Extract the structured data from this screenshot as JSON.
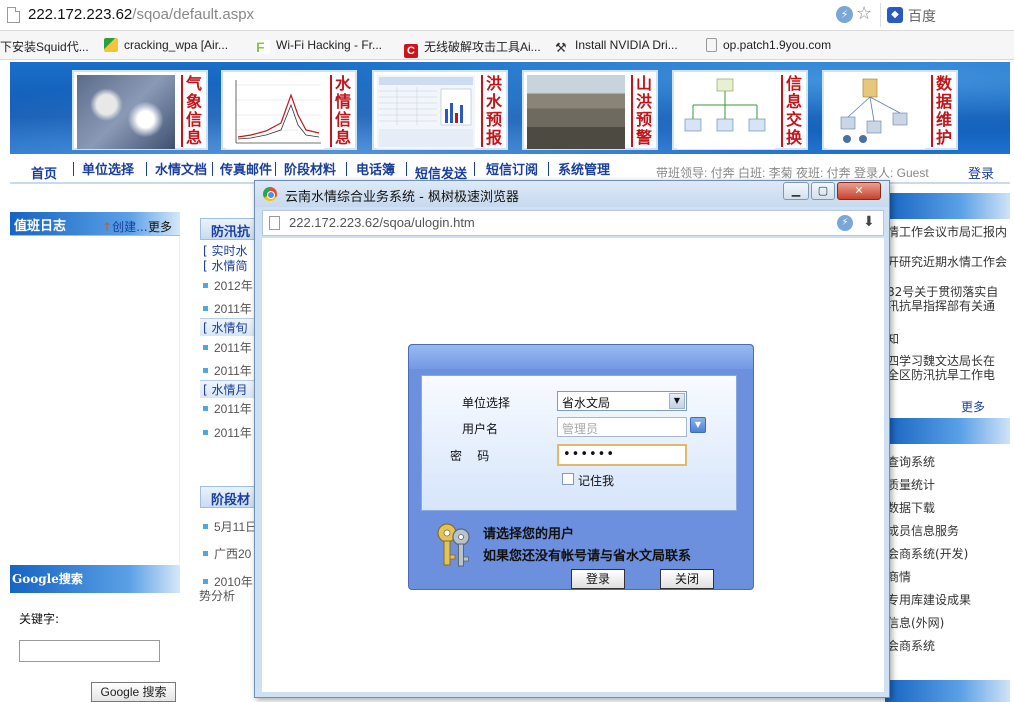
{
  "browser": {
    "url_host": "222.172.223.62",
    "url_path": "/sqoa/default.aspx",
    "search_engine": "百度"
  },
  "bookmarks": [
    {
      "label": "下安装Squid代...",
      "icon": "none",
      "color": ""
    },
    {
      "label": "cracking_wpa [Air...",
      "icon": "pencil-icon",
      "color": "#2e9e3a"
    },
    {
      "label": "Wi-Fi Hacking - Fr...",
      "icon": "f-logo-icon",
      "color": "#8bc34a"
    },
    {
      "label": "无线破解攻击工具Ai...",
      "icon": "c-logo-icon",
      "color": "#d0121b"
    },
    {
      "label": "Install NVIDIA Dri...",
      "icon": "wrench-icon",
      "color": "#555555"
    },
    {
      "label": "op.patch1.9you.com",
      "icon": "page-icon",
      "color": "#999999"
    }
  ],
  "header_tiles": [
    {
      "text": "气象信息",
      "picture": "weather-satellite-image"
    },
    {
      "text": "水情信息",
      "picture": "water-level-chart-image"
    },
    {
      "text": "洪水预报",
      "picture": "flood-forecast-table-image"
    },
    {
      "text": "山洪预警",
      "picture": "landslide-photo-image"
    },
    {
      "text": "信息交换",
      "picture": "network-diagram-image"
    },
    {
      "text": "数据维护",
      "picture": "server-diagram-image"
    }
  ],
  "nav": {
    "items": [
      "首页",
      "单位选择",
      "水情文档",
      "传真邮件",
      "阶段材料",
      "电话簿",
      "短信发送",
      "短信订阅",
      "系统管理"
    ],
    "duty_text": "带班领导: 付奔  白班: 李菊  夜班: 付奔  登录人: Guest",
    "login": "登录"
  },
  "left": {
    "duty_log_title": "值班日志",
    "create": "创建...",
    "more": "更多",
    "google_title": "Google搜索",
    "keyword_label": "关键字:",
    "search_button": "Google 搜索"
  },
  "middle": {
    "title_top": "防汛抗",
    "items": [
      {
        "kind": "link",
        "text": "[ 实时水"
      },
      {
        "kind": "link",
        "text": "[ 水情简"
      },
      {
        "kind": "line",
        "text": "2012年"
      },
      {
        "kind": "line",
        "text": "2011年"
      },
      {
        "kind": "link",
        "text": "[ 水情旬"
      },
      {
        "kind": "line",
        "text": "2011年"
      },
      {
        "kind": "line",
        "text": "2011年"
      },
      {
        "kind": "link",
        "text": "[ 水情月"
      },
      {
        "kind": "line",
        "text": "2011年"
      },
      {
        "kind": "line",
        "text": "2011年"
      }
    ],
    "title_stage": "阶段材",
    "stage_items": [
      "5月11日",
      "广西20",
      "2010年"
    ],
    "trailing": "势分析"
  },
  "right": {
    "items_top": [
      "情工作会议市局汇报内",
      "开研究近期水情工作会",
      "82号关于贯彻落实自",
      "汛抗旱指挥部有关通",
      "知",
      "四学习魏文达局长在",
      "全区防汛抗旱工作电"
    ],
    "more": "更多",
    "items_bottom": [
      "查询系统",
      "质量统计",
      "数据下载",
      "成员信息服务",
      "会商系统(开发)",
      "商情",
      "专用库建设成果",
      "信息(外网)",
      "会商系统"
    ]
  },
  "popup": {
    "title": "云南水情综合业务系统 - 枫树极速浏览器",
    "url": "222.172.223.62/sqoa/ulogin.htm",
    "login": {
      "unit_label": "单位选择",
      "unit_value": "省水文局",
      "username_label": "用户名",
      "username_placeholder": "管理员",
      "password_label": "密    码",
      "password_value": "••••••",
      "remember_label": "记住我",
      "hint_line1": "请选择您的用户",
      "hint_line2": "如果您还没有帐号请与省水文局联系",
      "login_button": "登录",
      "close_button": "关闭"
    }
  }
}
